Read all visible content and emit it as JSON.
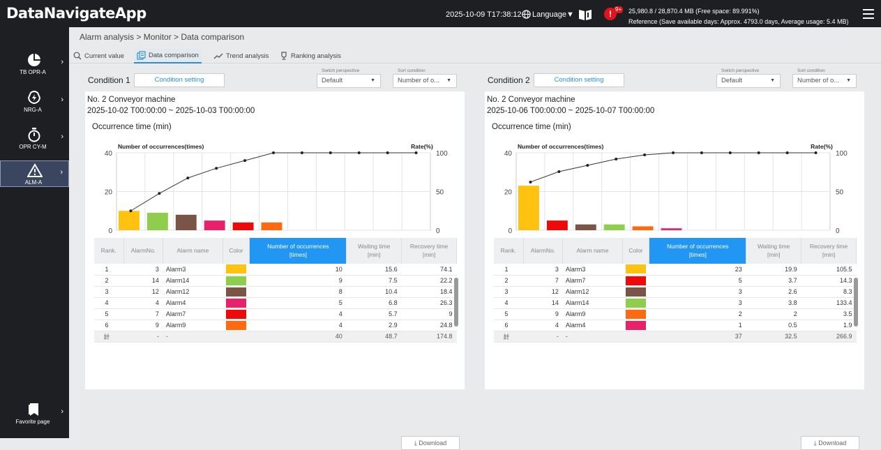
{
  "app": {
    "title": "DataNavigateApp"
  },
  "header": {
    "datetime": "2025-10-09 T17:38:12",
    "language": "Language▼",
    "alert_badge": "9+",
    "usage_line1": "25,980.8 / 28,870.4 MB (Free space: 89.991%)",
    "usage_line2": "Reference (Save available days: Approx. 4793.0 days, Average usage: 5.4 MB)"
  },
  "sidebar": {
    "items": [
      {
        "label": "TB OPR-A",
        "icon": "pie-chart-icon"
      },
      {
        "label": "NRG-A",
        "icon": "energy-icon"
      },
      {
        "label": "OPR CY-M",
        "icon": "stopwatch-icon"
      },
      {
        "label": "ALM-A",
        "icon": "warning-icon"
      },
      {
        "label": "Favorite page",
        "icon": "bookmark-icon"
      }
    ]
  },
  "breadcrumb": "Alarm analysis > Monitor > Data comparison",
  "tabs": [
    {
      "label": "Current value",
      "icon": "magnifier-icon"
    },
    {
      "label": "Data comparison",
      "icon": "compare-icon"
    },
    {
      "label": "Trend analysis",
      "icon": "trend-icon"
    },
    {
      "label": "Ranking analysis",
      "icon": "trophy-icon"
    }
  ],
  "common": {
    "condition_setting": "Condition setting",
    "switch_perspective_caption": "Switch perspective",
    "switch_perspective_value": "Default",
    "sort_condition_caption": "Sort condition",
    "sort_condition_value": "Number of o...",
    "download": "Download",
    "chart_left_label": "Number of occurrences(times)",
    "chart_right_label": "Rate(%)",
    "occurrence_title": "Occurrence time (min)",
    "table_headers": [
      "Rank.",
      "AlarmNo.",
      "Alarm name",
      "Color",
      "Number of occurrences\n[times]",
      "Waiting time\n[min]",
      "Recovery time\n[min]"
    ]
  },
  "conditions": [
    {
      "label": "Condition 1",
      "machine": "No. 2 Conveyor machine",
      "range": "2025-10-02 T00:00:00 ~ 2025-10-03 T00:00:00",
      "rows": [
        {
          "rank": "1",
          "no": "3",
          "name": "Alarm3",
          "color": "#ffc20e",
          "count": "10",
          "wait": "15.6",
          "recovery": "74.1"
        },
        {
          "rank": "2",
          "no": "14",
          "name": "Alarm14",
          "color": "#8fce4d",
          "count": "9",
          "wait": "7.5",
          "recovery": "22.2"
        },
        {
          "rank": "3",
          "no": "12",
          "name": "Alarm12",
          "color": "#7a5547",
          "count": "8",
          "wait": "10.4",
          "recovery": "18.4"
        },
        {
          "rank": "4",
          "no": "4",
          "name": "Alarm4",
          "color": "#e8226a",
          "count": "5",
          "wait": "6.8",
          "recovery": "26.3"
        },
        {
          "rank": "5",
          "no": "7",
          "name": "Alarm7",
          "color": "#ee0a0a",
          "count": "4",
          "wait": "5.7",
          "recovery": "9"
        },
        {
          "rank": "6",
          "no": "9",
          "name": "Alarm9",
          "color": "#ff6a10",
          "count": "4",
          "wait": "2.9",
          "recovery": "24.8"
        }
      ],
      "total": {
        "rank": "計",
        "no": "-",
        "name": "-",
        "count": "40",
        "wait": "48.7",
        "recovery": "174.8"
      }
    },
    {
      "label": "Condition 2",
      "machine": "No. 2 Conveyor machine",
      "range": "2025-10-06 T00:00:00 ~ 2025-10-07 T00:00:00",
      "rows": [
        {
          "rank": "1",
          "no": "3",
          "name": "Alarm3",
          "color": "#ffc20e",
          "count": "23",
          "wait": "19.9",
          "recovery": "105.5"
        },
        {
          "rank": "2",
          "no": "7",
          "name": "Alarm7",
          "color": "#ee0a0a",
          "count": "5",
          "wait": "3.7",
          "recovery": "14.3"
        },
        {
          "rank": "3",
          "no": "12",
          "name": "Alarm12",
          "color": "#7a5547",
          "count": "3",
          "wait": "2.6",
          "recovery": "8.3"
        },
        {
          "rank": "4",
          "no": "14",
          "name": "Alarm14",
          "color": "#8fce4d",
          "count": "3",
          "wait": "3.8",
          "recovery": "133.4"
        },
        {
          "rank": "5",
          "no": "9",
          "name": "Alarm9",
          "color": "#ff6a10",
          "count": "2",
          "wait": "2",
          "recovery": "3.5"
        },
        {
          "rank": "6",
          "no": "4",
          "name": "Alarm4",
          "color": "#e8226a",
          "count": "1",
          "wait": "0.5",
          "recovery": "1.9"
        }
      ],
      "total": {
        "rank": "計",
        "no": "-",
        "name": "-",
        "count": "37",
        "wait": "32.5",
        "recovery": "266.9"
      }
    }
  ],
  "chart_data": [
    {
      "type": "bar",
      "xlabel": "",
      "ylabel": "Number of occurrences(times)",
      "y2label": "Rate(%)",
      "ylim": [
        0,
        40
      ],
      "y2lim": [
        0,
        100
      ],
      "yticks": [
        0,
        20,
        40
      ],
      "y2ticks": [
        0,
        50,
        100
      ],
      "categories": [
        "Alarm3",
        "Alarm14",
        "Alarm12",
        "Alarm4",
        "Alarm7",
        "Alarm9"
      ],
      "values": [
        10,
        9,
        8,
        5,
        4,
        4
      ],
      "colors": [
        "#ffc20e",
        "#8fce4d",
        "#7a5547",
        "#e8226a",
        "#ee0a0a",
        "#ff6a10"
      ],
      "rate_line": [
        25,
        47.5,
        67.5,
        80,
        90,
        100,
        100,
        100,
        100,
        100,
        100
      ],
      "grid": true
    },
    {
      "type": "bar",
      "xlabel": "",
      "ylabel": "Number of occurrences(times)",
      "y2label": "Rate(%)",
      "ylim": [
        0,
        40
      ],
      "y2lim": [
        0,
        100
      ],
      "yticks": [
        0,
        20,
        40
      ],
      "y2ticks": [
        0,
        50,
        100
      ],
      "categories": [
        "Alarm3",
        "Alarm7",
        "Alarm12",
        "Alarm14",
        "Alarm9",
        "Alarm4"
      ],
      "values": [
        23,
        5,
        3,
        3,
        2,
        1
      ],
      "colors": [
        "#ffc20e",
        "#ee0a0a",
        "#7a5547",
        "#8fce4d",
        "#ff6a10",
        "#e8226a"
      ],
      "rate_line": [
        62.2,
        75.7,
        83.8,
        91.9,
        97.3,
        100,
        100,
        100,
        100,
        100,
        100
      ],
      "grid": true
    }
  ]
}
